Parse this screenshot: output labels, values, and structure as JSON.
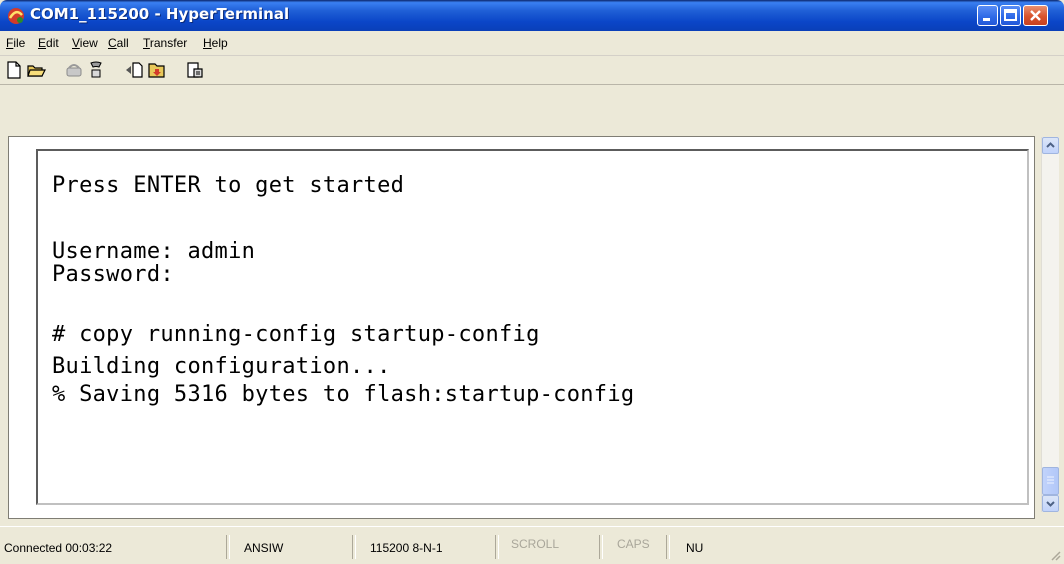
{
  "window": {
    "title": "COM1_115200 - HyperTerminal"
  },
  "menu": {
    "items": [
      {
        "hot": "F",
        "rest": "ile"
      },
      {
        "hot": "E",
        "rest": "dit"
      },
      {
        "hot": "V",
        "rest": "iew"
      },
      {
        "hot": "C",
        "rest": "all"
      },
      {
        "hot": "T",
        "rest": "ransfer"
      },
      {
        "hot": "H",
        "rest": "elp"
      }
    ]
  },
  "toolbar": {
    "icons": [
      "new-icon",
      "open-icon",
      "disconnect-icon",
      "connect-icon",
      "send-icon",
      "receive-icon",
      "properties-icon"
    ]
  },
  "terminal": {
    "lines": [
      "Press ENTER to get started",
      "Username: admin",
      "Password:",
      "# copy running-config startup-config",
      "Building configuration...",
      "% Saving 5316 bytes to flash:startup-config"
    ]
  },
  "status": {
    "connected": "Connected 00:03:22",
    "emulation": "ANSIW",
    "port_settings": "115200 8-N-1",
    "scroll": "SCROLL",
    "caps": "CAPS",
    "num": "NU"
  },
  "colors": {
    "titlebar": "#0b46c8",
    "close_button": "#d8532c",
    "status_dim": "#a9a69a"
  }
}
